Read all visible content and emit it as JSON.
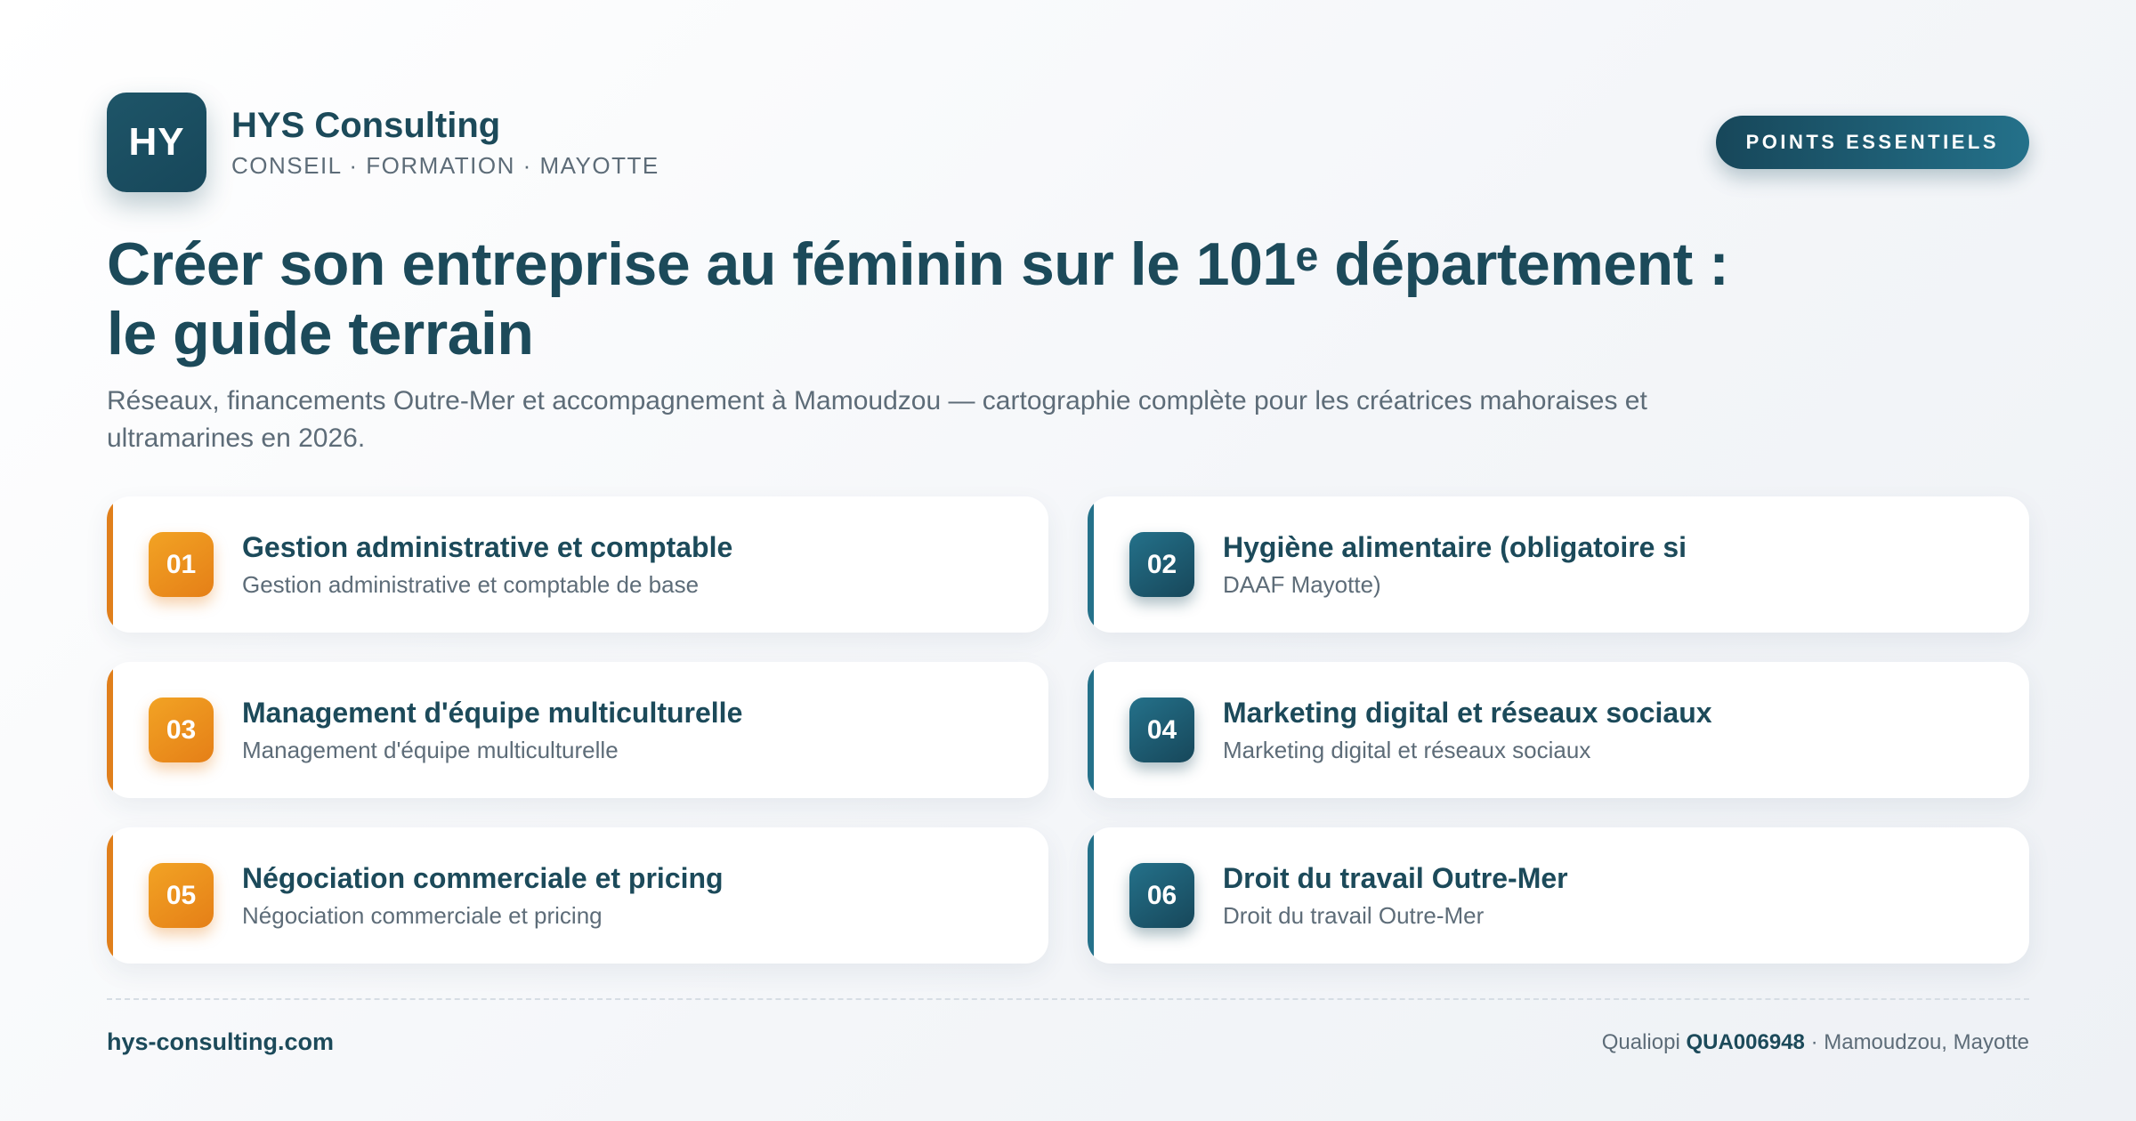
{
  "brand": {
    "logo_text": "HY",
    "name": "HYS Consulting",
    "tagline": "CONSEIL · FORMATION · MAYOTTE"
  },
  "badge": "POINTS ESSENTIELS",
  "title": {
    "line1": "Créer son entreprise au féminin sur le 101ᵉ département :",
    "line2": "le guide terrain"
  },
  "subtitle": "Réseaux, financements Outre-Mer et accompagnement à Mamoudzou — cartographie complète pour les créatrices mahoraises et ultramarines en 2026.",
  "cards": [
    {
      "number": "01",
      "title": "Gestion administrative et comptable",
      "description": "Gestion administrative et comptable de base"
    },
    {
      "number": "02",
      "title": "Hygiène alimentaire (obligatoire si",
      "description": "DAAF Mayotte)"
    },
    {
      "number": "03",
      "title": "Management d'équipe multiculturelle",
      "description": "Management d'équipe multiculturelle"
    },
    {
      "number": "04",
      "title": "Marketing digital et réseaux sociaux",
      "description": "Marketing digital et réseaux sociaux"
    },
    {
      "number": "05",
      "title": "Négociation commerciale et pricing",
      "description": "Négociation commerciale et pricing"
    },
    {
      "number": "06",
      "title": "Droit du travail Outre-Mer",
      "description": "Droit du travail Outre-Mer"
    }
  ],
  "footer": {
    "website": "hys-consulting.com",
    "certification_label": "Qualiopi",
    "certification_id": "QUA006948",
    "location": "· Mamoudzou, Mayotte"
  },
  "colors": {
    "primary": "#1c4a5a",
    "accent_orange": "#e57f17",
    "accent_teal": "#24718a",
    "muted_text": "#5d6c78"
  }
}
